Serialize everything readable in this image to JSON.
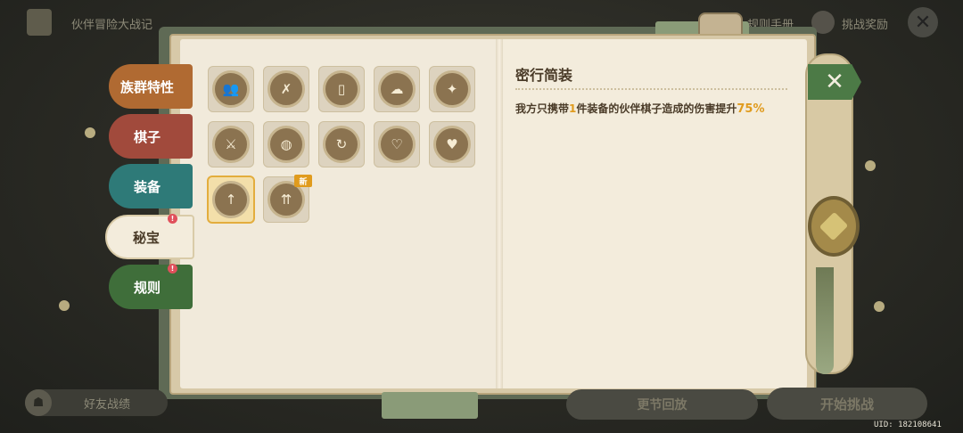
{
  "top_bar": {
    "title": "伙伴冒险大战记",
    "manual_label": "规则手册",
    "reward_label": "挑战奖励",
    "close_symbol": "✕"
  },
  "side_tabs": [
    {
      "label": "族群特性",
      "color": "#b06a32"
    },
    {
      "label": "棋子",
      "color": "#a14a3c"
    },
    {
      "label": "装备",
      "color": "#2e7a78"
    },
    {
      "label": "秘宝",
      "color": "#f3ecdc",
      "selected": true,
      "badge": "!"
    },
    {
      "label": "规则",
      "color": "#3f6e3a",
      "badge": "!"
    }
  ],
  "icons": [
    {
      "name": "group-icon",
      "glyph": "👥"
    },
    {
      "name": "card-cross-icon",
      "glyph": "✗"
    },
    {
      "name": "cards-icon",
      "glyph": "▯"
    },
    {
      "name": "clouds-icon",
      "glyph": "☁"
    },
    {
      "name": "badge-icon",
      "glyph": "✦"
    },
    {
      "name": "sword-icon",
      "glyph": "⚔"
    },
    {
      "name": "money-bag-icon",
      "glyph": "◍"
    },
    {
      "name": "refresh-icon",
      "glyph": "↻"
    },
    {
      "name": "broken-heart-icon",
      "glyph": "♡"
    },
    {
      "name": "heart-icon",
      "glyph": "♥"
    },
    {
      "name": "single-up-icon",
      "glyph": "↑",
      "selected": true
    },
    {
      "name": "double-up-icon",
      "glyph": "⇈",
      "new_label": "新"
    }
  ],
  "detail": {
    "title": "密行简装",
    "desc_prefix": "我方只携带",
    "desc_num": "1",
    "desc_middle": "件装备的伙伴棋子造成的伤害提升",
    "desc_pct": "75%"
  },
  "bottom": {
    "friend_label": "好友战绩",
    "mid_label": "更节回放",
    "start_label": "开始挑战",
    "uid": "UID: 182108641"
  },
  "right_panel": {
    "close_symbol": "✕"
  },
  "colors": {
    "accent": "#e09b1d",
    "page": "#f3ecdc"
  }
}
